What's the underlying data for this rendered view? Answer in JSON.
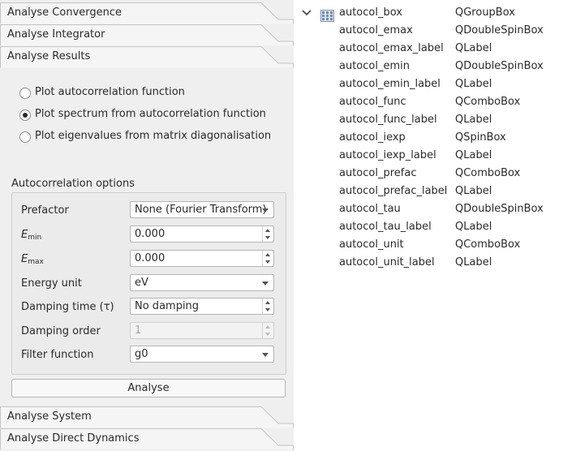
{
  "toolbox": {
    "tabs": {
      "convergence": "Analyse Convergence",
      "integrator": "Analyse Integrator",
      "results": "Analyse Results",
      "system": "Analyse System",
      "direct_dynamics": "Analyse Direct Dynamics"
    },
    "plot_options": [
      {
        "label": "Plot autocorrelation function",
        "checked": false
      },
      {
        "label": "Plot spectrum from autocorrelation function",
        "checked": true
      },
      {
        "label": "Plot eigenvalues from matrix diagonalisation",
        "checked": false
      }
    ],
    "group_title": "Autocorrelation options",
    "fields": {
      "prefactor": {
        "label": "Prefactor",
        "value": "None (Fourier Transform)"
      },
      "emin": {
        "label": "E",
        "sub": "min",
        "value": "0.000"
      },
      "emax": {
        "label": "E",
        "sub": "max",
        "value": "0.000"
      },
      "energy_unit": {
        "label": "Energy unit",
        "value": "eV"
      },
      "damping_time": {
        "label": "Damping time (τ)",
        "value": "No damping"
      },
      "damping_order": {
        "label": "Damping order",
        "value": "1",
        "enabled": false
      },
      "filter_function": {
        "label": "Filter function",
        "value": "g0"
      }
    },
    "analyse_button": "Analyse"
  },
  "object_tree": {
    "root": {
      "name": "autocol_box",
      "class": "QGroupBox",
      "expanded": true
    },
    "children": [
      {
        "name": "autocol_emax",
        "class": "QDoubleSpinBox"
      },
      {
        "name": "autocol_emax_label",
        "class": "QLabel"
      },
      {
        "name": "autocol_emin",
        "class": "QDoubleSpinBox"
      },
      {
        "name": "autocol_emin_label",
        "class": "QLabel"
      },
      {
        "name": "autocol_func",
        "class": "QComboBox"
      },
      {
        "name": "autocol_func_label",
        "class": "QLabel"
      },
      {
        "name": "autocol_iexp",
        "class": "QSpinBox"
      },
      {
        "name": "autocol_iexp_label",
        "class": "QLabel"
      },
      {
        "name": "autocol_prefac",
        "class": "QComboBox"
      },
      {
        "name": "autocol_prefac_label",
        "class": "QLabel"
      },
      {
        "name": "autocol_tau",
        "class": "QDoubleSpinBox"
      },
      {
        "name": "autocol_tau_label",
        "class": "QLabel"
      },
      {
        "name": "autocol_unit",
        "class": "QComboBox"
      },
      {
        "name": "autocol_unit_label",
        "class": "QLabel"
      }
    ]
  },
  "icons": {
    "tree_expand": "chevron-down-icon",
    "group_box": "grid-icon"
  }
}
